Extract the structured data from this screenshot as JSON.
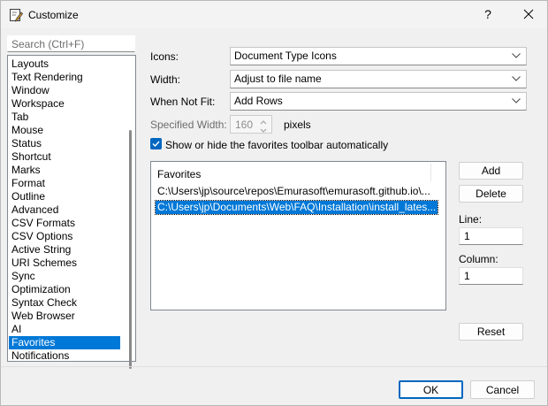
{
  "window": {
    "title": "Customize",
    "help_label": "?"
  },
  "search": {
    "placeholder": "Search (Ctrl+F)"
  },
  "categories": {
    "items": [
      "Layouts",
      "Text Rendering",
      "Window",
      "Workspace",
      "Tab",
      "Mouse",
      "Status",
      "Shortcut",
      "Marks",
      "Format",
      "Outline",
      "Advanced",
      "CSV Formats",
      "CSV Options",
      "Active String",
      "URI Schemes",
      "Sync",
      "Optimization",
      "Syntax Check",
      "Web Browser",
      "AI",
      "Favorites",
      "Notifications"
    ],
    "selected": "Favorites"
  },
  "form": {
    "icons_label": "Icons:",
    "icons_value": "Document Type Icons",
    "width_label": "Width:",
    "width_value": "Adjust to file name",
    "when_not_fit_label": "When Not Fit:",
    "when_not_fit_value": "Add Rows",
    "specified_width_label": "Specified Width:",
    "specified_width_value": "160",
    "pixels_label": "pixels",
    "auto_toolbar_label": "Show or hide the favorites toolbar automatically",
    "auto_toolbar_checked": true
  },
  "favorites": {
    "header": "Favorites",
    "rows": [
      "C:\\Users\\jp\\source\\repos\\Emurasoft\\emurasoft.github.io\\...",
      "C:\\Users\\jp\\Documents\\Web\\FAQ\\Installation\\install_lates..."
    ],
    "selected_index": 1
  },
  "side": {
    "add_label": "Add",
    "delete_label": "Delete",
    "line_label": "Line:",
    "line_value": "1",
    "column_label": "Column:",
    "column_value": "1",
    "reset_label": "Reset"
  },
  "footer": {
    "ok_label": "OK",
    "cancel_label": "Cancel"
  },
  "colors": {
    "accent": "#0078d7",
    "checkbox": "#0067c0"
  }
}
